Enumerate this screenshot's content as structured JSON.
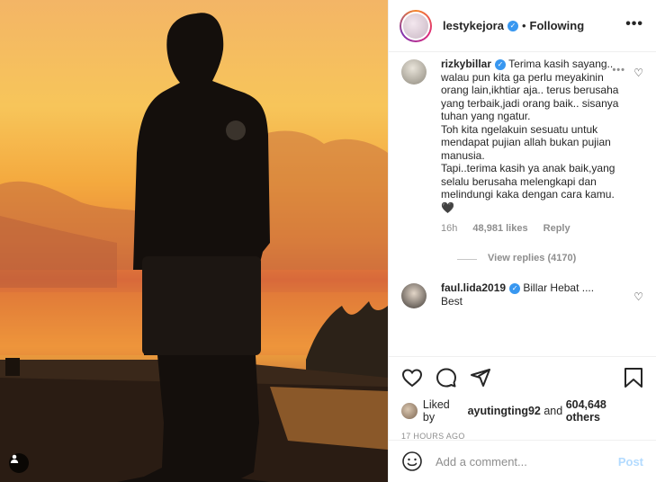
{
  "header": {
    "username": "lestykejora",
    "separator": "•",
    "follow_status": "Following",
    "more": "•••"
  },
  "comments": [
    {
      "username": "rizkybillar",
      "text": "Terima kasih sayang.. walau pun kita ga perlu meyakinin orang lain,ikhtiar aja.. terus berusaha yang terbaik,jadi orang baik.. sisanya tuhan yang ngatur.\nToh kita ngelakuin sesuatu untuk mendapat pujian allah bukan pujian manusia.\nTapi..terima kasih ya anak baik,yang selalu berusaha melengkapi dan melindungi kaka dengan cara kamu. 🖤",
      "time": "16h",
      "likes": "48,981 likes",
      "reply": "Reply",
      "view_replies": "View replies (4170)"
    },
    {
      "username": "faul.lida2019",
      "text": "Billar Hebat ....\nBest"
    }
  ],
  "likes": {
    "prefix": "Liked by",
    "user": "ayutingting92",
    "and": "and",
    "others": "604,648 others"
  },
  "timestamp": "17 HOURS AGO",
  "add_comment": {
    "placeholder": "Add a comment...",
    "post_label": "Post"
  },
  "colors": {
    "verified": "#3897f0",
    "post_disabled": "#b3dbff",
    "meta_gray": "#8e8e8e"
  }
}
